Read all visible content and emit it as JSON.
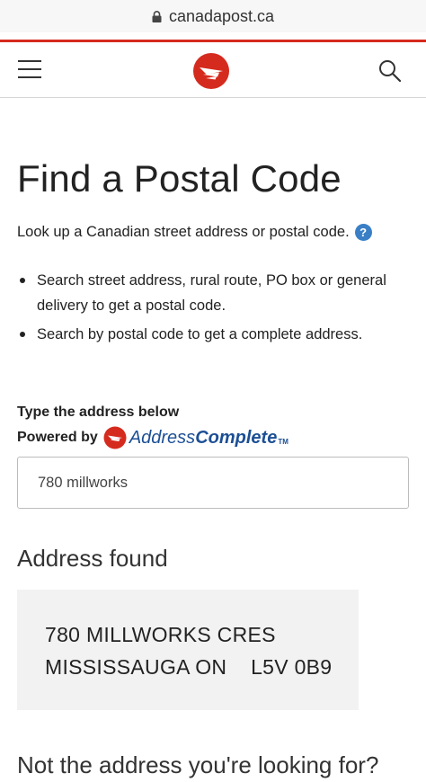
{
  "browser": {
    "url": "canadapost.ca"
  },
  "colors": {
    "brand_red": "#d52b1e",
    "help_blue": "#3a7fc6",
    "ac_blue": "#1c4f95"
  },
  "header": {
    "menu_icon": "hamburger-menu-icon",
    "logo_icon": "canada-post-logo",
    "search_icon": "search-icon"
  },
  "page": {
    "title": "Find a Postal Code",
    "intro": "Look up a Canadian street address or postal code.",
    "help_symbol": "?",
    "bullets": [
      "Search street address, rural route, PO box or general delivery to get a postal code.",
      "Search by postal code to get a complete address."
    ]
  },
  "search": {
    "label": "Type the address below",
    "powered_by": "Powered by",
    "brand_part1": "Address",
    "brand_part2": "Complete",
    "brand_tm": "TM",
    "value": "780 millworks"
  },
  "result": {
    "heading": "Address found",
    "line1": "780 MILLWORKS CRES",
    "line2": "MISSISSAUGA ON    L5V 0B9"
  },
  "footer_prompt": "Not the address you're looking for?"
}
